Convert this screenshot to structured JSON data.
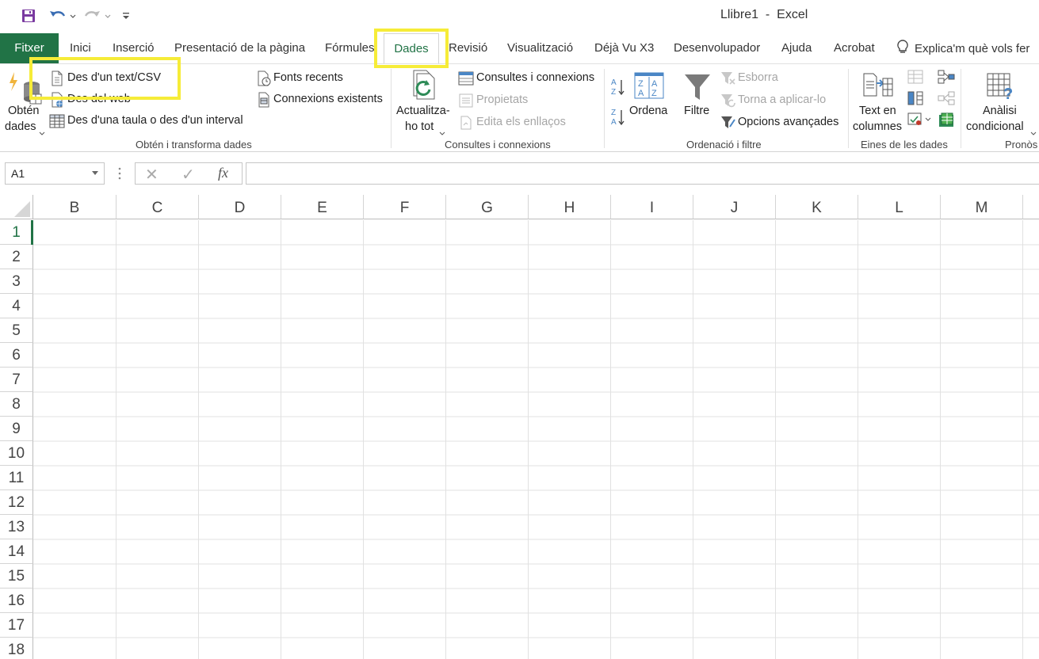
{
  "titlebar": {
    "title": "Llibre1  -  Excel",
    "quick_access": [
      "save-icon",
      "undo-icon",
      "redo-icon",
      "customize-icon"
    ]
  },
  "tabs": {
    "file": "Fitxer",
    "items": [
      "Inici",
      "Inserció",
      "Presentació de la pàgina",
      "Fórmules",
      "Dades",
      "Revisió",
      "Visualització",
      "Déjà Vu X3",
      "Desenvolupador",
      "Ajuda",
      "Acrobat"
    ],
    "active": "Dades",
    "tell_me": "Explica'm què vols fer"
  },
  "ribbon": {
    "get_transform": {
      "get_data_line1": "Obtén",
      "get_data_line2": "dades",
      "from_text_csv": "Des d'un text/CSV",
      "from_web": "Des del web",
      "from_table": "Des d'una taula o des d'un interval",
      "recent_sources": "Fonts recents",
      "existing_connections": "Connexions existents",
      "group_label": "Obtén i transforma dades"
    },
    "queries": {
      "refresh_line1": "Actualitza-",
      "refresh_line2": "ho tot",
      "queries_connections": "Consultes i connexions",
      "properties": "Propietats",
      "edit_links": "Edita els enllaços",
      "group_label": "Consultes i connexions"
    },
    "sort_filter": {
      "sort": "Ordena",
      "filter": "Filtre",
      "clear": "Esborra",
      "reapply": "Torna a aplicar-lo",
      "advanced": "Opcions avançades",
      "group_label": "Ordenació i filtre"
    },
    "data_tools": {
      "text_to_columns_line1": "Text en",
      "text_to_columns_line2": "columnes",
      "group_label": "Eines de les dades"
    },
    "forecast": {
      "whatif_line1": "Anàlisi",
      "whatif_line2": "condicional",
      "group_label": "Pronòs"
    }
  },
  "formula_bar": {
    "name_box": "A1",
    "cancel": "✕",
    "enter": "✓",
    "fx": "fx",
    "value": ""
  },
  "sheet": {
    "columns": [
      "B",
      "C",
      "D",
      "E",
      "F",
      "G",
      "H",
      "I",
      "J",
      "K",
      "L",
      "M"
    ],
    "rows": [
      "1",
      "2",
      "3",
      "4",
      "5",
      "6",
      "7",
      "8",
      "9",
      "10",
      "11",
      "12",
      "13",
      "14",
      "15",
      "16",
      "17",
      "18"
    ],
    "selected_row": "1"
  },
  "colors": {
    "accent": "#217346",
    "highlight": "#f6ec38"
  }
}
